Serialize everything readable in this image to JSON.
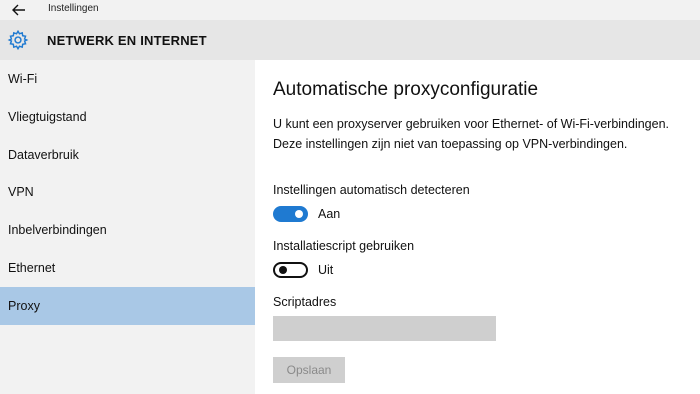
{
  "titlebar": {
    "title": "Instellingen"
  },
  "header": {
    "title": "NETWERK EN INTERNET"
  },
  "sidebar": {
    "items": [
      {
        "label": "Wi-Fi"
      },
      {
        "label": "Vliegtuigstand"
      },
      {
        "label": "Dataverbruik"
      },
      {
        "label": "VPN"
      },
      {
        "label": "Inbelverbindingen"
      },
      {
        "label": "Ethernet"
      },
      {
        "label": "Proxy",
        "active": true
      }
    ]
  },
  "main": {
    "title": "Automatische proxyconfiguratie",
    "description": "U kunt een proxyserver gebruiken voor Ethernet- of Wi-Fi-verbindingen. Deze instellingen zijn niet van toepassing op VPN-verbindingen.",
    "auto_detect": {
      "label": "Instellingen automatisch detecteren",
      "state": "Aan",
      "on": true
    },
    "script": {
      "label": "Installatiescript gebruiken",
      "state": "Uit",
      "on": false
    },
    "script_address": {
      "label": "Scriptadres",
      "value": "",
      "placeholder": ""
    },
    "save_button": {
      "label": "Opslaan",
      "disabled": true
    }
  },
  "colors": {
    "accent": "#1f7ad1",
    "sidebar_active": "#a9c8e6",
    "header_bg": "#e6e6e6"
  },
  "icons": [
    "back-arrow-icon",
    "gear-icon"
  ]
}
